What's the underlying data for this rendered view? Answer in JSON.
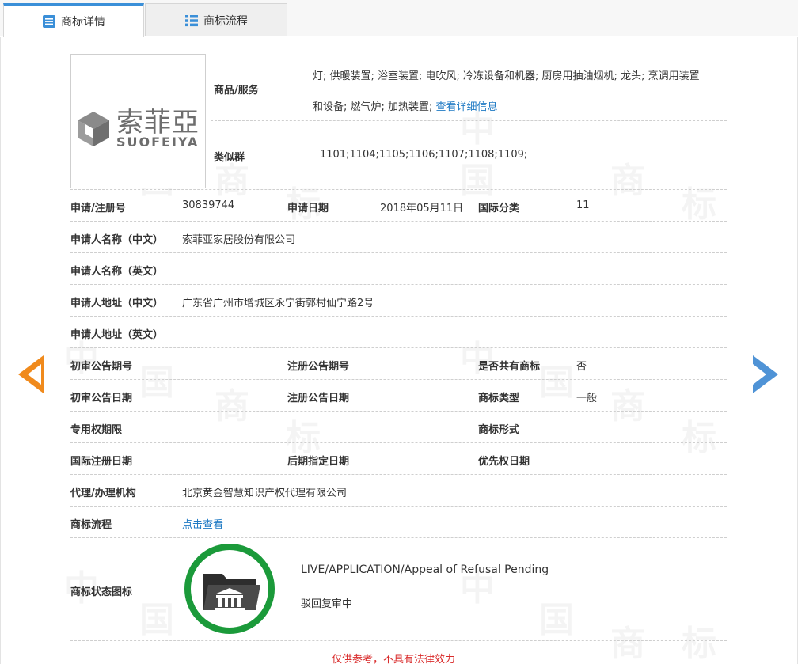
{
  "tabs": [
    {
      "label": "商标详情",
      "icon": "document-list-icon",
      "active": true
    },
    {
      "label": "商标流程",
      "icon": "list-icon",
      "active": false
    }
  ],
  "logo": {
    "cn": "索菲亞",
    "en": "SUOFEIYA"
  },
  "goods": {
    "label": "商品/服务",
    "text_line1": "灯; 供暖装置; 浴室装置; 电吹风; 冷冻设备和机器; 厨房用抽油烟机; 龙头; 烹调用装置",
    "text_line2": "和设备; 燃气炉; 加热装置;",
    "detail_link": "查看详细信息"
  },
  "similar_group": {
    "label": "类似群",
    "value": "1101;1104;1105;1106;1107;1108;1109;"
  },
  "reg_number": {
    "label": "申请/注册号",
    "value": "30839744"
  },
  "apply_date": {
    "label": "申请日期",
    "value": "2018年05月11日"
  },
  "intl_class": {
    "label": "国际分类",
    "value": "11"
  },
  "applicant_cn": {
    "label": "申请人名称（中文）",
    "value": "索菲亚家居股份有限公司"
  },
  "applicant_en": {
    "label": "申请人名称（英文）",
    "value": ""
  },
  "address_cn": {
    "label": "申请人地址（中文）",
    "value": "广东省广州市增城区永宁街郭村仙宁路2号"
  },
  "address_en": {
    "label": "申请人地址（英文）",
    "value": ""
  },
  "prelim_pub_no": {
    "label": "初审公告期号",
    "value": ""
  },
  "reg_pub_no": {
    "label": "注册公告期号",
    "value": ""
  },
  "shared": {
    "label": "是否共有商标",
    "value": "否"
  },
  "prelim_pub_date": {
    "label": "初审公告日期",
    "value": ""
  },
  "reg_pub_date": {
    "label": "注册公告日期",
    "value": ""
  },
  "tm_type": {
    "label": "商标类型",
    "value": "一般"
  },
  "exclusive_period": {
    "label": "专用权期限",
    "value": ""
  },
  "tm_form": {
    "label": "商标形式",
    "value": ""
  },
  "intl_reg_date": {
    "label": "国际注册日期",
    "value": ""
  },
  "later_designation": {
    "label": "后期指定日期",
    "value": ""
  },
  "priority_date": {
    "label": "优先权日期",
    "value": ""
  },
  "agent": {
    "label": "代理/办理机构",
    "value": "北京黄金智慧知识产权代理有限公司"
  },
  "process": {
    "label": "商标流程",
    "link": "点击查看"
  },
  "status": {
    "label": "商标状态图标",
    "en": "LIVE/APPLICATION/Appeal of Refusal Pending",
    "cn": "驳回复审中",
    "icon": "folder-court-icon",
    "ring_color": "#1b9a3a"
  },
  "disclaimer": "仅供参考，不具有法律效力",
  "nav": {
    "prev_icon": "prev-arrow-icon",
    "next_icon": "next-arrow-icon"
  },
  "watermark": [
    "中",
    "国",
    "商",
    "标"
  ],
  "colors": {
    "accent": "#3a8fd8",
    "link": "#1f7ac4",
    "warning": "#d92b2b",
    "prev_arrow": "#f08a1c",
    "next_arrow": "#4f93d6"
  }
}
